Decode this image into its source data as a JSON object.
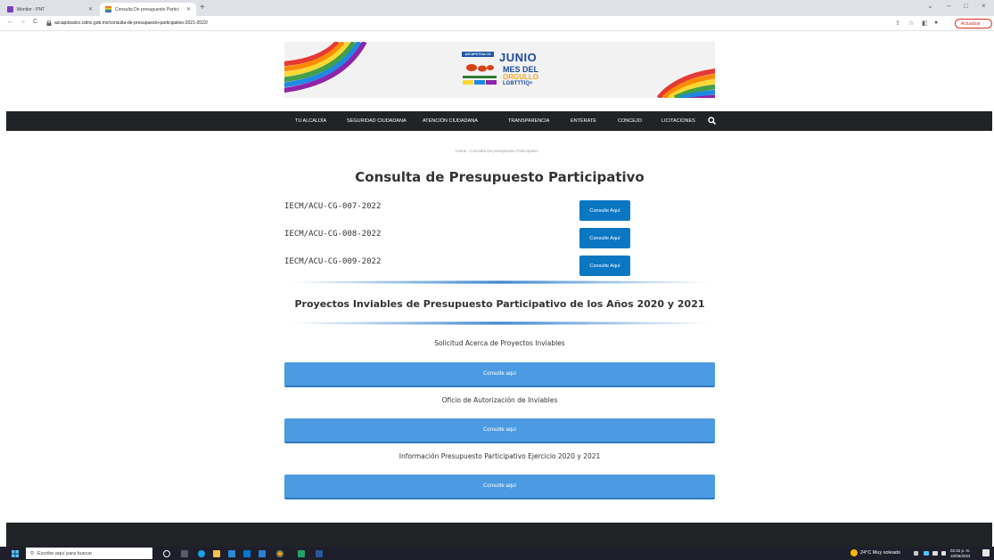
{
  "browser": {
    "tabs": [
      {
        "title": "Monitor - PNT"
      },
      {
        "title": "Consulta De presupuesto Partici"
      }
    ],
    "new_tab": "+",
    "window_controls": {
      "chevron": "⌄",
      "minimize": "–",
      "maximize": "□",
      "close": "×"
    },
    "url": "azcapotzalco.cdmx.gob.mx/consulta-de-presupuesto-participativo-2021-2022/",
    "update_button": "Actualizar",
    "icons": {
      "back": "arrow-left-icon",
      "forward": "arrow-right-icon",
      "reload": "reload-icon",
      "lock": "lock-icon"
    }
  },
  "banner": {
    "org_tag": "AZCAPOTZALCO",
    "line1": "JUNIO",
    "line2": "MES DEL",
    "line3": "ORGULLO",
    "line4": "LGBTTTIQ+"
  },
  "nav": {
    "items": [
      "TU ALCALDÍA",
      "SEGURIDAD CIUDADANA",
      "ATENCIÓN CIUDADANA",
      "TRANSPARENCIA",
      "ENTÉRATE",
      "CONCEJO",
      "LICITACIONES"
    ]
  },
  "breadcrumb": "Home  ›  Consulta De presupuesto Participativo",
  "page_title": "Consulta de Presupuesto Participativo",
  "documents": [
    {
      "code": "IECM/ACU-CG-007-2022",
      "button": "Consulte Aquí"
    },
    {
      "code": "IECM/ACU-CG-008-2022",
      "button": "Consulte Aquí"
    },
    {
      "code": "IECM/ACU-CG-009-2022",
      "button": "Consulte Aquí"
    }
  ],
  "section_heading": "Proyectos Inviables de Presupuesto Participativo de los Años 2020 y 2021",
  "resources": [
    {
      "label": "Solicitud Acerca de Proyectos Inviables",
      "button": "Consulte aquí"
    },
    {
      "label": "Oficio de Autorización de Inviables",
      "button": "Consulte aquí"
    },
    {
      "label": "Información Presupuesto Participativo Ejercicio 2020 y 2021",
      "button": "Consulte aquí"
    }
  ],
  "taskbar": {
    "search_placeholder": "Escribe aquí para buscar",
    "weather": "24°C  Muy soleado",
    "time": "02:22 p. m.",
    "date": "10/06/2022"
  },
  "colors": {
    "nav_bg": "#202426",
    "primary_button": "#0b77c2",
    "wide_button": "#4c9ae1",
    "taskbar": "#1f1f2b"
  }
}
